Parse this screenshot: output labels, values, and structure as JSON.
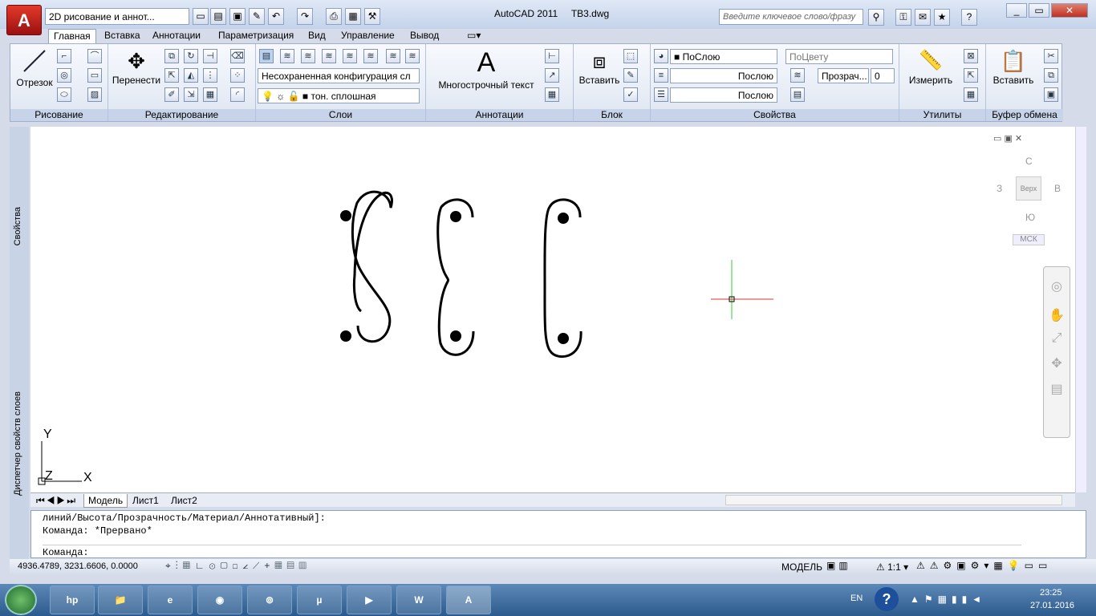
{
  "app": {
    "title": "AutoCAD 2011",
    "file": "TB3.dwg",
    "workspace": "2D рисование и аннот...",
    "search_placeholder": "Введите ключевое слово/фразу"
  },
  "tabs": [
    "Главная",
    "Вставка",
    "Аннотации",
    "Параметризация",
    "Вид",
    "Управление",
    "Вывод"
  ],
  "ribbon": {
    "draw": {
      "label": "Рисование",
      "line": "Отрезок"
    },
    "modify": {
      "label": "Редактирование",
      "move": "Перенести"
    },
    "layers": {
      "label": "Слои",
      "config": "Несохраненная конфигурация сл",
      "layer": "тон. сплошная"
    },
    "annotation": {
      "label": "Аннотации",
      "mtext": "Многострочный текст"
    },
    "block": {
      "label": "Блок",
      "insert": "Вставить"
    },
    "properties": {
      "label": "Свойства",
      "color": "ПоСлою",
      "plotstyle": "ПоЦвету",
      "linetype": "Послою",
      "lineweight": "Послою",
      "transparency_label": "Прозрач...",
      "transparency_value": "0"
    },
    "utilities": {
      "label": "Утилиты",
      "measure": "Измерить"
    },
    "clipboard": {
      "label": "Буфер обмена",
      "paste": "Вставить"
    }
  },
  "viewcube": {
    "north": "С",
    "south": "Ю",
    "west": "З",
    "east": "В",
    "top": "Верх",
    "ucs": "МСК"
  },
  "side": {
    "properties": "Свойства",
    "layer_manager": "Диспетчер свойств слоев"
  },
  "ucs_icon": {
    "x": "X",
    "y": "Y",
    "z": "Z"
  },
  "layout_tabs": [
    "Модель",
    "Лист1",
    "Лист2"
  ],
  "command": {
    "line1": "линий/Высота/Прозрачность/Материал/Аннотативный]:",
    "line2": "Команда: *Прервано*",
    "prompt": "Команда:"
  },
  "status": {
    "coords": "4936.4789, 3231.6606, 0.0000",
    "model": "МОДЕЛЬ",
    "scale": "1:1"
  },
  "taskbar": {
    "lang": "EN",
    "time": "23:25",
    "date": "27.01.2016",
    "apps": [
      "hp-icon",
      "explorer-icon",
      "ie-icon",
      "media-icon",
      "chrome-icon",
      "utorrent-icon",
      "kmplayer-icon",
      "word-icon",
      "autocad-icon"
    ]
  }
}
